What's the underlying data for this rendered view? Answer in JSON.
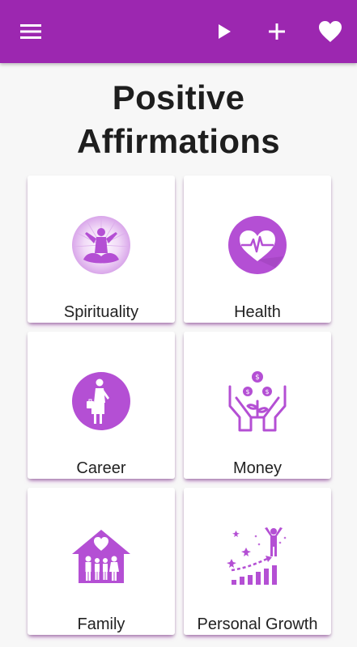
{
  "appbar": {
    "color": "#9c27b0",
    "icons": [
      "menu-icon",
      "play-icon",
      "add-icon",
      "heart-icon"
    ]
  },
  "title": {
    "line1": "Positive",
    "line2": "Affirmations"
  },
  "categories": [
    {
      "label": "Spirituality",
      "icon": "meditation-icon"
    },
    {
      "label": "Health",
      "icon": "heart-pulse-icon"
    },
    {
      "label": "Career",
      "icon": "businesswoman-icon"
    },
    {
      "label": "Money",
      "icon": "money-hands-icon"
    },
    {
      "label": "Family",
      "icon": "family-house-icon"
    },
    {
      "label": "Personal Growth",
      "icon": "growth-chart-icon"
    }
  ],
  "accent": "#b44fd4"
}
